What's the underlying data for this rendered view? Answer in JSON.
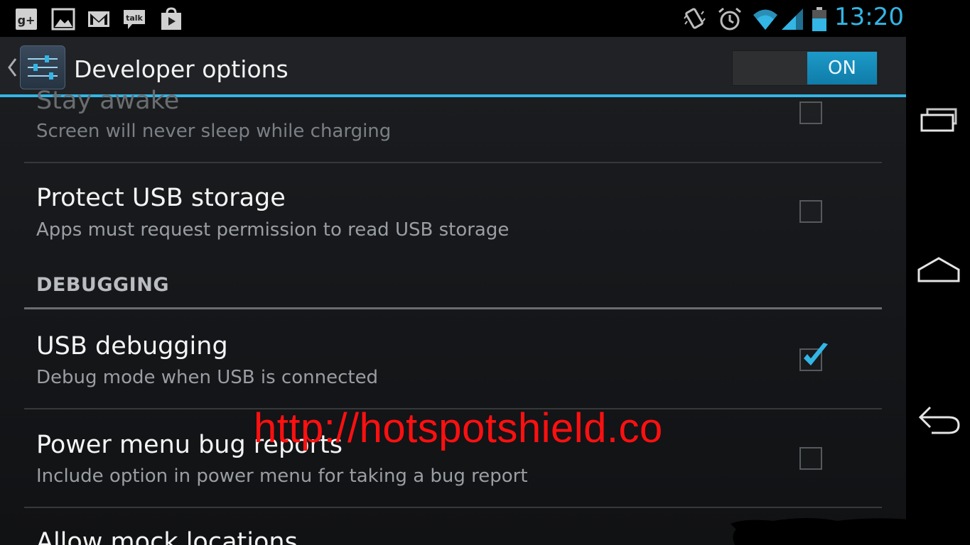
{
  "status_bar": {
    "time": "13:20",
    "notification_icons": [
      "google-plus-icon",
      "gallery-icon",
      "gmail-icon",
      "talk-icon",
      "play-store-icon"
    ],
    "system_icons": [
      "vibrate-icon",
      "alarm-icon",
      "wifi-icon",
      "signal-icon",
      "battery-icon"
    ],
    "talk_text": "talk",
    "gplus_text": "g+"
  },
  "action_bar": {
    "title": "Developer options",
    "toggle_label": "ON",
    "accent_color": "#33b5e5"
  },
  "settings": {
    "items": [
      {
        "title": "Stay awake",
        "summary": "Screen will never sleep while charging",
        "checked": false
      },
      {
        "title": "Protect USB storage",
        "summary": "Apps must request permission to read USB storage",
        "checked": false
      },
      {
        "title": "USB debugging",
        "summary": "Debug mode when USB is connected",
        "checked": true
      },
      {
        "title": "Power menu bug reports",
        "summary": "Include option in power menu for taking a bug report",
        "checked": false
      },
      {
        "title": "Allow mock locations",
        "summary": "",
        "checked": false
      }
    ],
    "section_header": "DEBUGGING"
  },
  "watermark": {
    "text": "http://hotspotshield.co",
    "color": "#ff1010"
  },
  "nav_bar": {
    "buttons": [
      "recent-apps-icon",
      "home-icon",
      "back-icon"
    ]
  }
}
